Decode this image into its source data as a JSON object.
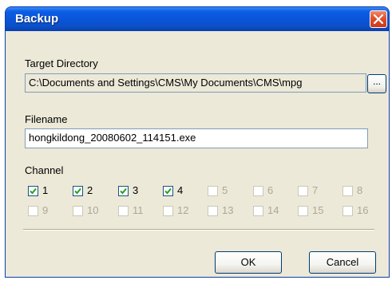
{
  "window": {
    "title": "Backup"
  },
  "target_directory": {
    "label": "Target Directory",
    "value": "C:\\Documents and Settings\\CMS\\My Documents\\CMS\\mpg",
    "browse_label": "..."
  },
  "filename": {
    "label": "Filename",
    "value": "hongkildong_20080602_114151.exe"
  },
  "channel": {
    "label": "Channel",
    "channels": [
      {
        "number": "1",
        "checked": true,
        "enabled": true
      },
      {
        "number": "2",
        "checked": true,
        "enabled": true
      },
      {
        "number": "3",
        "checked": true,
        "enabled": true
      },
      {
        "number": "4",
        "checked": true,
        "enabled": true
      },
      {
        "number": "5",
        "checked": false,
        "enabled": false
      },
      {
        "number": "6",
        "checked": false,
        "enabled": false
      },
      {
        "number": "7",
        "checked": false,
        "enabled": false
      },
      {
        "number": "8",
        "checked": false,
        "enabled": false
      },
      {
        "number": "9",
        "checked": false,
        "enabled": false
      },
      {
        "number": "10",
        "checked": false,
        "enabled": false
      },
      {
        "number": "11",
        "checked": false,
        "enabled": false
      },
      {
        "number": "12",
        "checked": false,
        "enabled": false
      },
      {
        "number": "13",
        "checked": false,
        "enabled": false
      },
      {
        "number": "14",
        "checked": false,
        "enabled": false
      },
      {
        "number": "15",
        "checked": false,
        "enabled": false
      },
      {
        "number": "16",
        "checked": false,
        "enabled": false
      }
    ]
  },
  "buttons": {
    "ok_label": "OK",
    "cancel_label": "Cancel"
  }
}
